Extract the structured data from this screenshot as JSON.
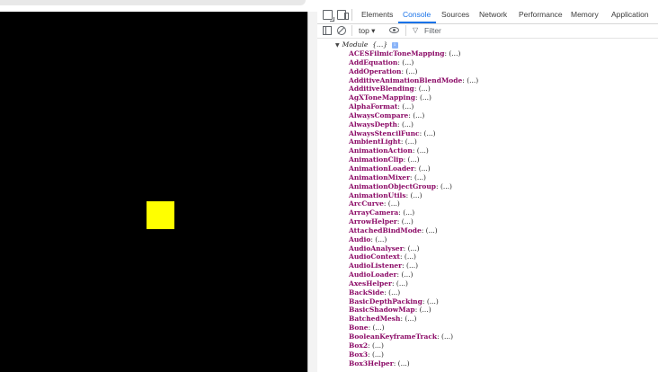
{
  "devtools": {
    "tabs": [
      {
        "label": "Elements",
        "active": false
      },
      {
        "label": "Console",
        "active": true
      },
      {
        "label": "Sources",
        "active": false
      },
      {
        "label": "Network",
        "active": false
      },
      {
        "label": "Performance",
        "active": false
      },
      {
        "label": "Memory",
        "active": false
      },
      {
        "label": "Application",
        "active": false
      }
    ],
    "toolbar": {
      "context": "top ▾",
      "filter_placeholder": "Filter"
    },
    "console": {
      "module_label": "Module",
      "module_preview": "{…}",
      "info_badge": "i",
      "properties": [
        {
          "key": "ACESFilmicToneMapping",
          "value": "(...)"
        },
        {
          "key": "AddEquation",
          "value": "(...)"
        },
        {
          "key": "AddOperation",
          "value": "(...)"
        },
        {
          "key": "AdditiveAnimationBlendMode",
          "value": "(...)"
        },
        {
          "key": "AdditiveBlending",
          "value": "(...)"
        },
        {
          "key": "AgXToneMapping",
          "value": "(...)"
        },
        {
          "key": "AlphaFormat",
          "value": "(...)"
        },
        {
          "key": "AlwaysCompare",
          "value": "(...)"
        },
        {
          "key": "AlwaysDepth",
          "value": "(...)"
        },
        {
          "key": "AlwaysStencilFunc",
          "value": "(...)"
        },
        {
          "key": "AmbientLight",
          "value": "(...)"
        },
        {
          "key": "AnimationAction",
          "value": "(...)"
        },
        {
          "key": "AnimationClip",
          "value": "(...)"
        },
        {
          "key": "AnimationLoader",
          "value": "(...)"
        },
        {
          "key": "AnimationMixer",
          "value": "(...)"
        },
        {
          "key": "AnimationObjectGroup",
          "value": "(...)"
        },
        {
          "key": "AnimationUtils",
          "value": "(...)"
        },
        {
          "key": "ArcCurve",
          "value": "(...)"
        },
        {
          "key": "ArrayCamera",
          "value": "(...)"
        },
        {
          "key": "ArrowHelper",
          "value": "(...)"
        },
        {
          "key": "AttachedBindMode",
          "value": "(...)"
        },
        {
          "key": "Audio",
          "value": "(...)"
        },
        {
          "key": "AudioAnalyser",
          "value": "(...)"
        },
        {
          "key": "AudioContext",
          "value": "(...)"
        },
        {
          "key": "AudioListener",
          "value": "(...)"
        },
        {
          "key": "AudioLoader",
          "value": "(...)"
        },
        {
          "key": "AxesHelper",
          "value": "(...)"
        },
        {
          "key": "BackSide",
          "value": "(...)"
        },
        {
          "key": "BasicDepthPacking",
          "value": "(...)"
        },
        {
          "key": "BasicShadowMap",
          "value": "(...)"
        },
        {
          "key": "BatchedMesh",
          "value": "(...)"
        },
        {
          "key": "Bone",
          "value": "(...)"
        },
        {
          "key": "BooleanKeyframeTrack",
          "value": "(...)"
        },
        {
          "key": "Box2",
          "value": "(...)"
        },
        {
          "key": "Box3",
          "value": "(...)"
        },
        {
          "key": "Box3Helper",
          "value": "(...)"
        }
      ]
    }
  },
  "colors": {
    "canvas_background": "#000000",
    "square": "#ffff00",
    "accent": "#1a73e8",
    "property_key": "#8b0a66"
  }
}
